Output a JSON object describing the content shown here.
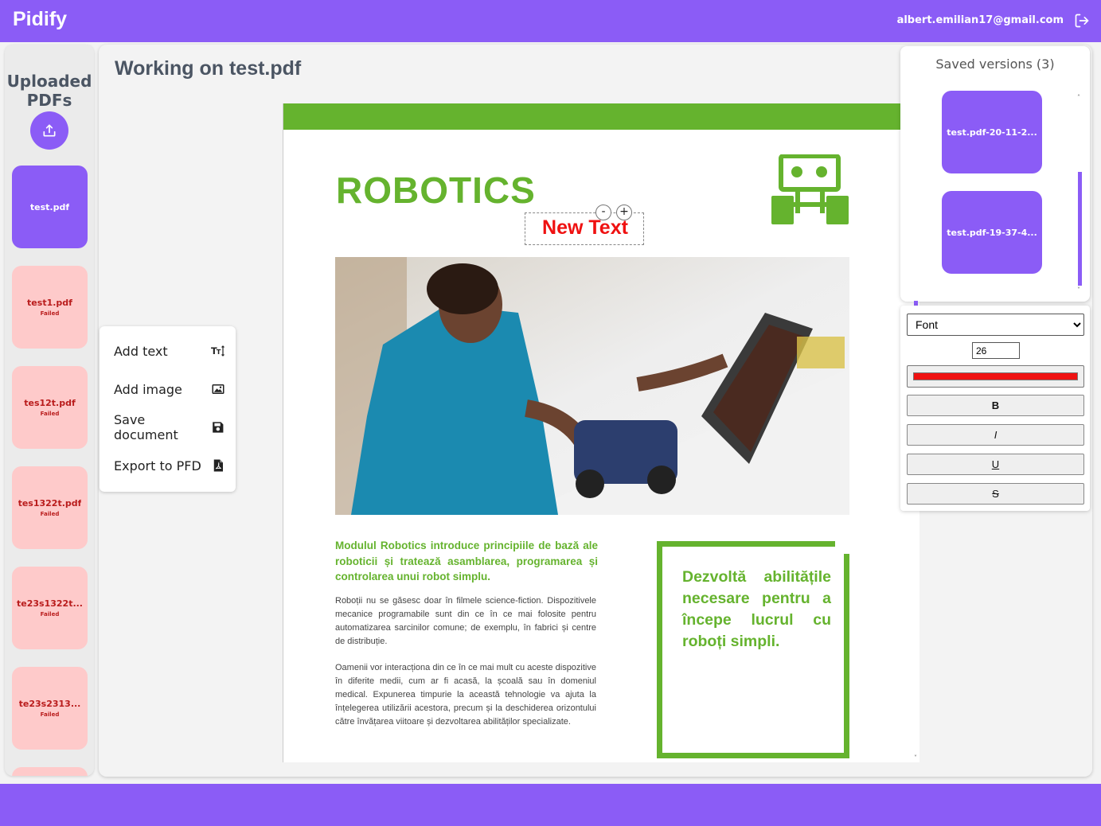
{
  "app": {
    "name": "Pidify",
    "user_email": "albert.emilian17@gmail.com"
  },
  "sidebar": {
    "title": "Uploaded PDFs",
    "files": [
      {
        "name": "test.pdf",
        "status": ""
      },
      {
        "name": "test1.pdf",
        "status": "Failed"
      },
      {
        "name": "tes12t.pdf",
        "status": "Failed"
      },
      {
        "name": "tes1322t.pdf",
        "status": "Failed"
      },
      {
        "name": "te23s1322t...",
        "status": "Failed"
      },
      {
        "name": "te23s2313...",
        "status": "Failed"
      }
    ]
  },
  "main": {
    "title": "Working on test.pdf"
  },
  "tools": {
    "add_text": "Add text",
    "add_image": "Add image",
    "save_document": "Save document",
    "export": "Export to PFD"
  },
  "document": {
    "heading": "ROBOTICS",
    "new_text": "New Text",
    "minus": "-",
    "plus": "+",
    "lead": "Modulul Robotics introduce principiile de bază ale roboticii și tratează asamblarea, programarea și controlarea unui robot simplu.",
    "para1": "Roboții nu se găsesc doar în filmele science-fiction. Dispozitivele mecanice programabile sunt din ce în ce mai folosite pentru automatizarea sarcinilor comune; de exemplu, în fabrici și centre de distribuție.",
    "para2": "Oamenii vor interacționa din ce în ce mai mult cu aceste dispozitive în diferite medii, cum ar fi acasă, la școală sau în domeniul medical. Expunerea timpurie la această tehnologie va ajuta la înțelegerea utilizării acestora, precum și la deschiderea orizontului către învățarea viitoare și dezvoltarea abilităților specializate.",
    "callout": "Dezvoltă abilitățile necesare pentru a începe lucrul cu roboți simpli."
  },
  "versions": {
    "title": "Saved versions (3)",
    "items": [
      "test.pdf-20-11-2...",
      "test.pdf-19-37-4..."
    ]
  },
  "props": {
    "font_placeholder": "Font",
    "font_size": "26",
    "text_color": "#ef1111",
    "bold": "B",
    "italic": "I",
    "underline": "U",
    "strike": "S"
  },
  "colors": {
    "accent": "#8b5cf6",
    "doc_green": "#65b32e",
    "failed_bg": "#fecaca",
    "failed_text": "#b91c1c"
  }
}
